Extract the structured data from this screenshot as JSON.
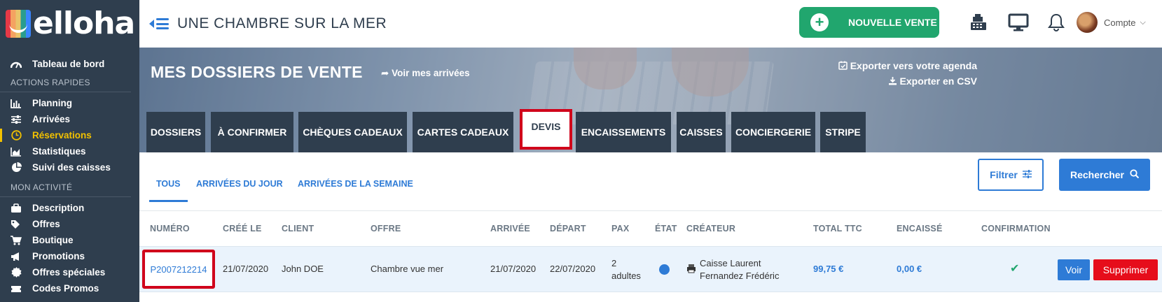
{
  "brand": {
    "name": "elloha"
  },
  "sidebar": {
    "dashboard": {
      "label": "Tableau de bord",
      "icon": "dashboard-gauge-icon"
    },
    "quick_actions_title": "ACTIONS RAPIDES",
    "quick_actions": [
      {
        "label": "Planning",
        "icon": "bar-chart-icon"
      },
      {
        "label": "Arrivées",
        "icon": "sliders-icon"
      },
      {
        "label": "Réservations",
        "icon": "clock-icon",
        "active": true
      },
      {
        "label": "Statistiques",
        "icon": "area-chart-icon"
      },
      {
        "label": "Suivi des caisses",
        "icon": "pie-chart-icon"
      }
    ],
    "activity_title": "MON ACTIVITÉ",
    "activity": [
      {
        "label": "Description",
        "icon": "briefcase-icon"
      },
      {
        "label": "Offres",
        "icon": "tags-icon"
      },
      {
        "label": "Boutique",
        "icon": "cart-icon"
      },
      {
        "label": "Promotions",
        "icon": "megaphone-icon"
      },
      {
        "label": "Offres spéciales",
        "icon": "badge-icon"
      },
      {
        "label": "Codes Promos",
        "icon": "ticket-icon"
      }
    ]
  },
  "topbar": {
    "hotel_name": "UNE CHAMBRE SUR LA MER",
    "new_sale_label": "NOUVELLE VENTE",
    "account_label": "Compte"
  },
  "banner": {
    "title": "MES DOSSIERS DE VENTE",
    "arrivals_link": "Voir mes arrivées",
    "export_agenda": "Exporter vers votre agenda",
    "export_csv": "Exporter en CSV"
  },
  "tabs": [
    {
      "label": "DOSSIERS"
    },
    {
      "label": "À CONFIRMER"
    },
    {
      "label": "CHÈQUES CADEAUX"
    },
    {
      "label": "CARTES CADEAUX"
    },
    {
      "label": "DEVIS",
      "active": true
    },
    {
      "label": "ENCAISSEMENTS"
    },
    {
      "label": "CAISSES"
    },
    {
      "label": "CONCIERGERIE"
    },
    {
      "label": "STRIPE"
    }
  ],
  "subtabs": [
    {
      "label": "TOUS",
      "active": true
    },
    {
      "label": "ARRIVÉES DU JOUR"
    },
    {
      "label": "ARRIVÉES DE LA SEMAINE"
    }
  ],
  "buttons": {
    "filter": "Filtrer",
    "search": "Rechercher",
    "view": "Voir",
    "delete": "Supprimer"
  },
  "table": {
    "headers": [
      "NUMÉRO",
      "CRÉÉ LE",
      "CLIENT",
      "OFFRE",
      "ARRIVÉE",
      "DÉPART",
      "PAX",
      "ÉTAT",
      "CRÉATEUR",
      "TOTAL TTC",
      "ENCAISSÉ",
      "CONFIRMATION"
    ],
    "rows": [
      {
        "numero": "P2007212214",
        "cree_le": "21/07/2020",
        "client": "John DOE",
        "offre": "Chambre vue mer",
        "arrivee": "21/07/2020",
        "depart": "22/07/2020",
        "pax_line1": "2",
        "pax_line2": "adultes",
        "etat_color": "#2e7bd6",
        "createur_line1": "Caisse Laurent",
        "createur_line2": "Fernandez Frédéric",
        "total_ttc": "99,75 €",
        "encaisse": "0,00 €",
        "confirmation": "✔"
      }
    ]
  },
  "colors": {
    "sidebar": "#2f3e4e",
    "accent_blue": "#2e7bd6",
    "green": "#21a66e",
    "highlight_red": "#d0021b",
    "active_yellow": "#f2c100"
  }
}
